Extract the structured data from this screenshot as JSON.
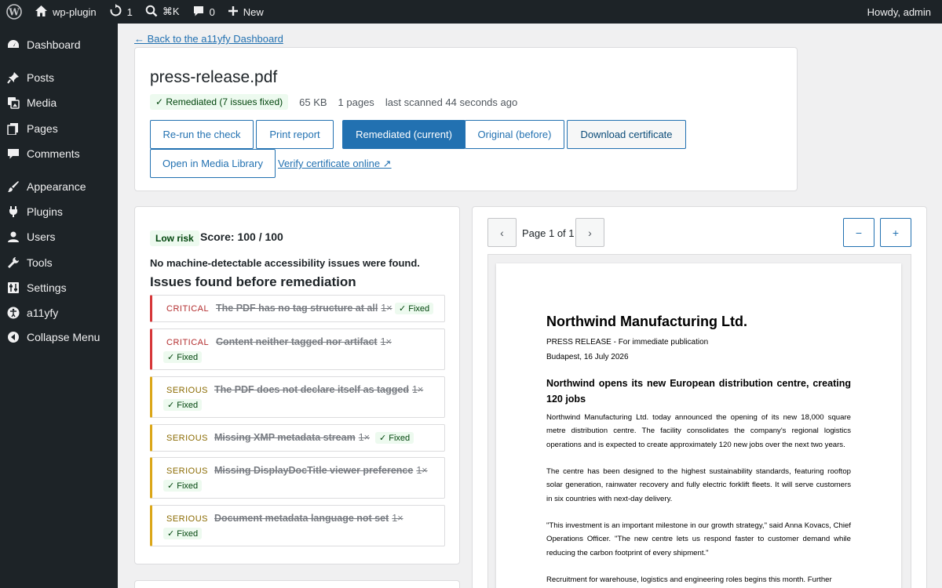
{
  "adminbar": {
    "site_name": "wp-plugin",
    "updates_count": "1",
    "search_shortcut": "⌘K",
    "comments_count": "0",
    "new_label": "New",
    "greeting": "Howdy, admin"
  },
  "sidebar": {
    "items": [
      {
        "label": "Dashboard",
        "icon": "dashboard-icon"
      },
      {
        "label": "Posts",
        "icon": "pin-icon"
      },
      {
        "label": "Media",
        "icon": "media-icon"
      },
      {
        "label": "Pages",
        "icon": "pages-icon"
      },
      {
        "label": "Comments",
        "icon": "comments-icon"
      },
      {
        "label": "Appearance",
        "icon": "brush-icon"
      },
      {
        "label": "Plugins",
        "icon": "plug-icon"
      },
      {
        "label": "Users",
        "icon": "users-icon"
      },
      {
        "label": "Tools",
        "icon": "wrench-icon"
      },
      {
        "label": "Settings",
        "icon": "settings-icon"
      },
      {
        "label": "a11yfy",
        "icon": "accessibility-icon"
      },
      {
        "label": "Collapse Menu",
        "icon": "collapse-icon"
      }
    ]
  },
  "back_link": "← Back to the a11yfy Dashboard",
  "file": {
    "name": "press-release.pdf",
    "status": "✓ Remediated (7 issues fixed)",
    "size": "65 KB",
    "pages": "1 pages",
    "scanned": "last scanned 44 seconds ago"
  },
  "actions": {
    "rerun": "Re-run the check",
    "print": "Print report",
    "remediated": "Remediated (current)",
    "original": "Original (before)",
    "download": "Download certificate",
    "media_library": "Open in Media Library",
    "verify": "Verify certificate online ↗"
  },
  "report": {
    "risk": "Low risk",
    "score": "Score: 100 / 100",
    "no_issues": "No machine-detectable accessibility issues were found.",
    "heading": "Issues found before remediation",
    "fixed_label": "✓ Fixed",
    "issues": [
      {
        "severity": "CRITICAL",
        "title": "The PDF has no tag structure at all",
        "count": "1×"
      },
      {
        "severity": "CRITICAL",
        "title": "Content neither tagged nor artifact",
        "count": "1×"
      },
      {
        "severity": "SERIOUS",
        "title": "The PDF does not declare itself as tagged",
        "count": "1×"
      },
      {
        "severity": "SERIOUS",
        "title": "Missing XMP metadata stream",
        "count": "1×"
      },
      {
        "severity": "SERIOUS",
        "title": "Missing DisplayDocTitle viewer preference",
        "count": "1×"
      },
      {
        "severity": "SERIOUS",
        "title": "Document metadata language not set",
        "count": "1×"
      }
    ]
  },
  "preview": {
    "prev": "‹",
    "next": "›",
    "page_label": "Page 1 of 1",
    "zoom_out": "−",
    "zoom_in": "+",
    "doc": {
      "company": "Northwind Manufacturing Ltd.",
      "press_line": "PRESS RELEASE - For immediate publication",
      "dateline": "Budapest, 16 July 2026",
      "headline": "Northwind opens its new European distribution centre, creating 120 jobs",
      "para1": "Northwind Manufacturing Ltd. today announced the opening of its new 18,000 square metre distribution centre. The facility consolidates the company's regional logistics operations and is expected to create approximately 120 new jobs over the next two years.",
      "para2": "The centre has been designed to the highest sustainability standards, featuring rooftop solar generation, rainwater recovery and fully electric forklift fleets. It will serve customers in six countries with next-day delivery.",
      "para3": "\"This investment is an important milestone in our growth strategy,\" said Anna Kovacs, Chief Operations Officer. \"The new centre lets us respond faster to customer demand while reducing the carbon footprint of every shipment.\"",
      "para4": "Recruitment for warehouse, logistics and engineering roles begins this month. Further"
    }
  },
  "colors": {
    "accent": "#2271b1",
    "critical": "#d63638",
    "serious": "#dba617",
    "success_bg": "#edfaef"
  }
}
